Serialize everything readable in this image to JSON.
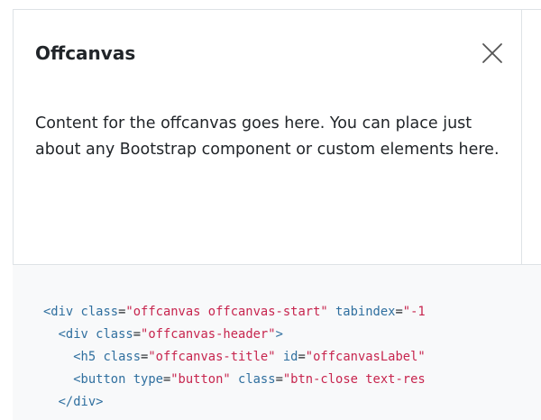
{
  "offcanvas": {
    "title": "Offcanvas",
    "close_icon": "close-x-icon",
    "body": "Content for the offcanvas goes here. You can place just about any Bootstrap component or custom elements here."
  },
  "code": {
    "lines": [
      {
        "indent": "",
        "parts": [
          {
            "t": "tag",
            "v": "<div"
          },
          {
            "t": "punc",
            "v": " "
          },
          {
            "t": "attr",
            "v": "class"
          },
          {
            "t": "punc",
            "v": "="
          },
          {
            "t": "val",
            "v": "\"offcanvas offcanvas-start\""
          },
          {
            "t": "punc",
            "v": " "
          },
          {
            "t": "attr",
            "v": "tabindex"
          },
          {
            "t": "punc",
            "v": "="
          },
          {
            "t": "val",
            "v": "\"-1"
          }
        ]
      },
      {
        "indent": "  ",
        "parts": [
          {
            "t": "tag",
            "v": "<div"
          },
          {
            "t": "punc",
            "v": " "
          },
          {
            "t": "attr",
            "v": "class"
          },
          {
            "t": "punc",
            "v": "="
          },
          {
            "t": "val",
            "v": "\"offcanvas-header\""
          },
          {
            "t": "tag",
            "v": ">"
          }
        ]
      },
      {
        "indent": "    ",
        "parts": [
          {
            "t": "tag",
            "v": "<h5"
          },
          {
            "t": "punc",
            "v": " "
          },
          {
            "t": "attr",
            "v": "class"
          },
          {
            "t": "punc",
            "v": "="
          },
          {
            "t": "val",
            "v": "\"offcanvas-title\""
          },
          {
            "t": "punc",
            "v": " "
          },
          {
            "t": "attr",
            "v": "id"
          },
          {
            "t": "punc",
            "v": "="
          },
          {
            "t": "val",
            "v": "\"offcanvasLabel\""
          }
        ]
      },
      {
        "indent": "    ",
        "parts": [
          {
            "t": "tag",
            "v": "<button"
          },
          {
            "t": "punc",
            "v": " "
          },
          {
            "t": "attr",
            "v": "type"
          },
          {
            "t": "punc",
            "v": "="
          },
          {
            "t": "val",
            "v": "\"button\""
          },
          {
            "t": "punc",
            "v": " "
          },
          {
            "t": "attr",
            "v": "class"
          },
          {
            "t": "punc",
            "v": "="
          },
          {
            "t": "val",
            "v": "\"btn-close text-res"
          }
        ]
      },
      {
        "indent": "  ",
        "parts": [
          {
            "t": "tag",
            "v": "</div>"
          }
        ]
      }
    ]
  },
  "colors": {
    "tag": "#2f6f9f",
    "value": "#c7254e",
    "code_bg": "#f8f9fa",
    "border": "#dee2e6"
  }
}
